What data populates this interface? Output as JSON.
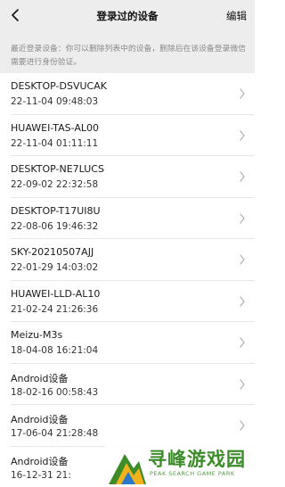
{
  "navbar": {
    "back_icon": "back-arrow-icon",
    "title": "登录过的设备",
    "edit_label": "编辑"
  },
  "notice": {
    "text": "最近登录设备：你可以删除列表中的设备，删除后在该设备登录微信需要进行身份验证。"
  },
  "devices": [
    {
      "name": "DESKTOP-DSVUCAK",
      "time": "22-11-04 09:48:03"
    },
    {
      "name": "HUAWEI-TAS-AL00",
      "time": "22-11-04 01:11:11"
    },
    {
      "name": "DESKTOP-NE7LUCS",
      "time": "22-09-02 22:32:58"
    },
    {
      "name": "DESKTOP-T17UI8U",
      "time": "22-08-06 19:46:32"
    },
    {
      "name": "SKY-20210507AJJ",
      "time": "22-01-29 14:03:02"
    },
    {
      "name": "HUAWEI-LLD-AL10",
      "time": "21-02-24 21:26:36"
    },
    {
      "name": "Meizu-M3s",
      "time": "18-04-08 16:21:04"
    },
    {
      "name": "Android设备",
      "time": "18-02-16 00:58:43"
    },
    {
      "name": "Android设备",
      "time": "17-06-04 21:28:48"
    },
    {
      "name": "Android设备",
      "time": "16-12-31 21:"
    }
  ],
  "watermark": {
    "title": "寻峰游戏园",
    "subtitle": "PEAK SEARCH GAME PARK"
  },
  "colors": {
    "navbar_bg": "#ededed",
    "watermark_green": "#3d8c2a"
  }
}
